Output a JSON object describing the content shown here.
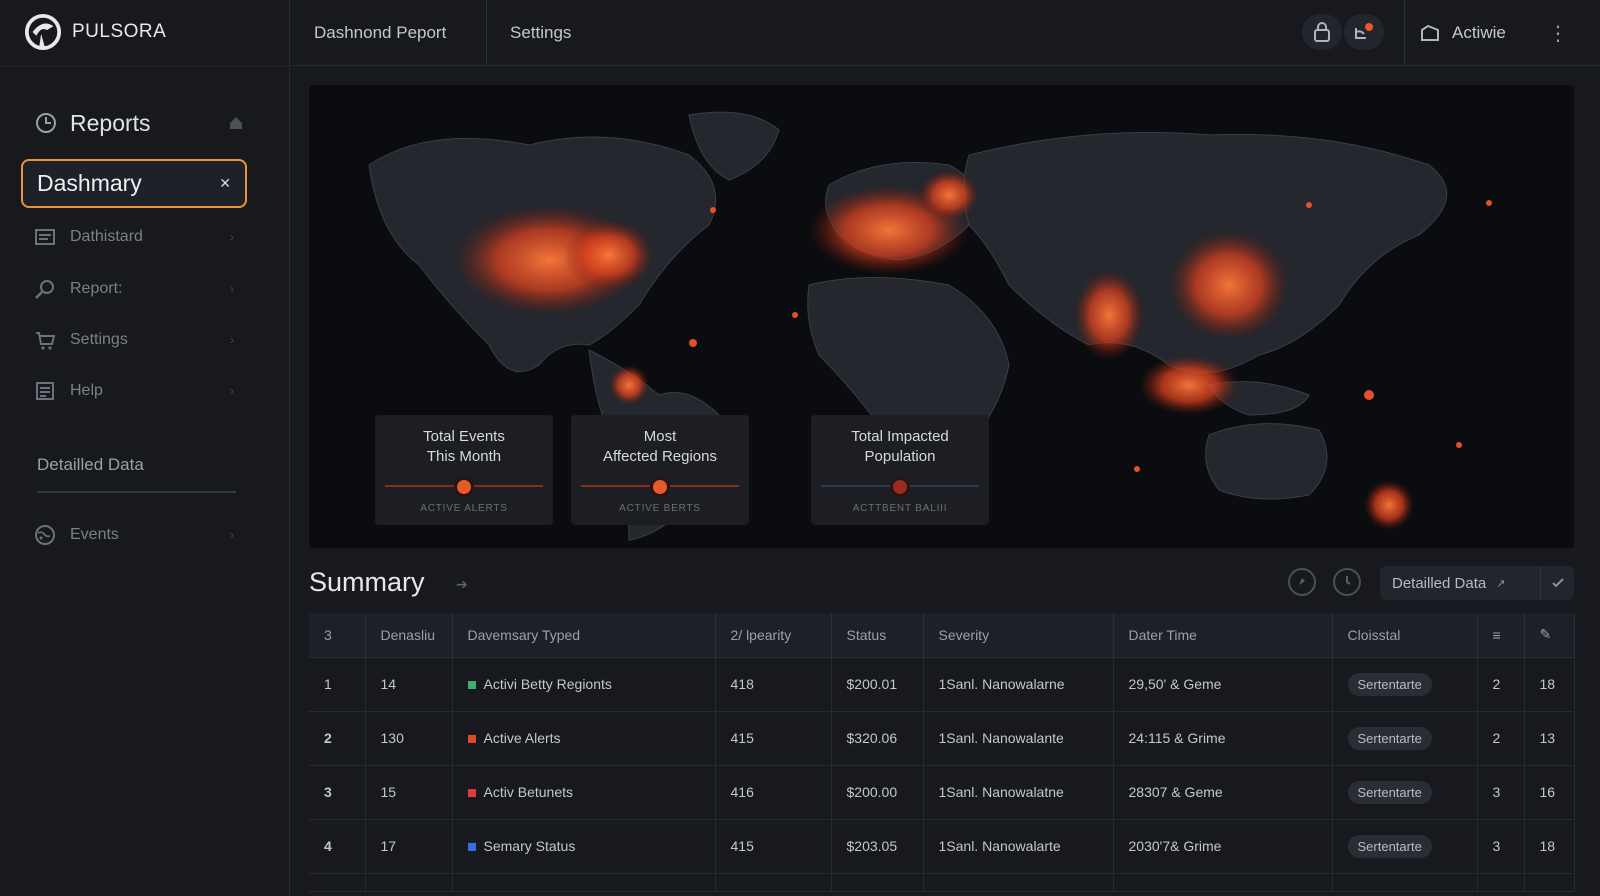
{
  "brand": {
    "name": "PULSORA"
  },
  "topbar": {
    "tabs": [
      "Dashnond Peport",
      "Settings"
    ],
    "user_label": "Actiwie"
  },
  "sidebar": {
    "header": "Reports",
    "active_item": "Dashmary",
    "items": [
      {
        "label": "Dathistard",
        "icon": "list-icon"
      },
      {
        "label": "Report:",
        "icon": "search-icon"
      },
      {
        "label": "Settings",
        "icon": "cart-icon"
      },
      {
        "label": "Help",
        "icon": "document-icon"
      }
    ],
    "section_title": "Detailled Data",
    "section_items": [
      {
        "label": "Events",
        "icon": "globe-icon"
      }
    ]
  },
  "map": {
    "cards": [
      {
        "title_line1": "Total Events",
        "title_line2": "This Month",
        "footer": "ACTIVE ALERTS"
      },
      {
        "title_line1": "Most",
        "title_line2": "Affected Regions",
        "footer": "ACTIVE BERTS"
      },
      {
        "title_line1": "Total Impacted",
        "title_line2": "Population",
        "footer": "ACTTBENT BALIII"
      }
    ],
    "heat_color": "#e4502a"
  },
  "summary": {
    "title": "Summary",
    "detail_button": "Detailled Data"
  },
  "table": {
    "headers": [
      "3",
      "Denasliu",
      "Davemsary Typed",
      "2/ lpearity",
      "Status",
      "Severity",
      "Dater Time",
      "Cloisstal",
      "",
      ""
    ],
    "rows": [
      {
        "idx": "1",
        "den": "14",
        "type": "Activi Betty Regionts",
        "type_color": "#3fae6a",
        "lp": "418",
        "status": "$200.01",
        "severity": "1Sanl. Nanowalarne",
        "time": "29,50' & Geme",
        "badge": "Sertentarte",
        "c1": "2",
        "c2": "18"
      },
      {
        "idx": "2",
        "den": "130",
        "type": "Active Alerts",
        "type_color": "#e0472a",
        "lp": "415",
        "status": "$320.06",
        "severity": "1Sanl. Nanowalante",
        "time": "24:115 & Grime",
        "badge": "Sertentarte",
        "c1": "2",
        "c2": "13"
      },
      {
        "idx": "3",
        "den": "15",
        "type": "Activ Betunets",
        "type_color": "#e03a3a",
        "lp": "416",
        "status": "$200.00",
        "severity": "1Sanl. Nanowalatne",
        "time": "28307 & Geme",
        "badge": "Sertentarte",
        "c1": "3",
        "c2": "16"
      },
      {
        "idx": "4",
        "den": "17",
        "type": "Semary Status",
        "type_color": "#3a6ee0",
        "lp": "415",
        "status": "$203.05",
        "severity": "1Sanl. Nanowalarte",
        "time": "2030'7& Grime",
        "badge": "Sertentarte",
        "c1": "3",
        "c2": "18"
      }
    ]
  }
}
